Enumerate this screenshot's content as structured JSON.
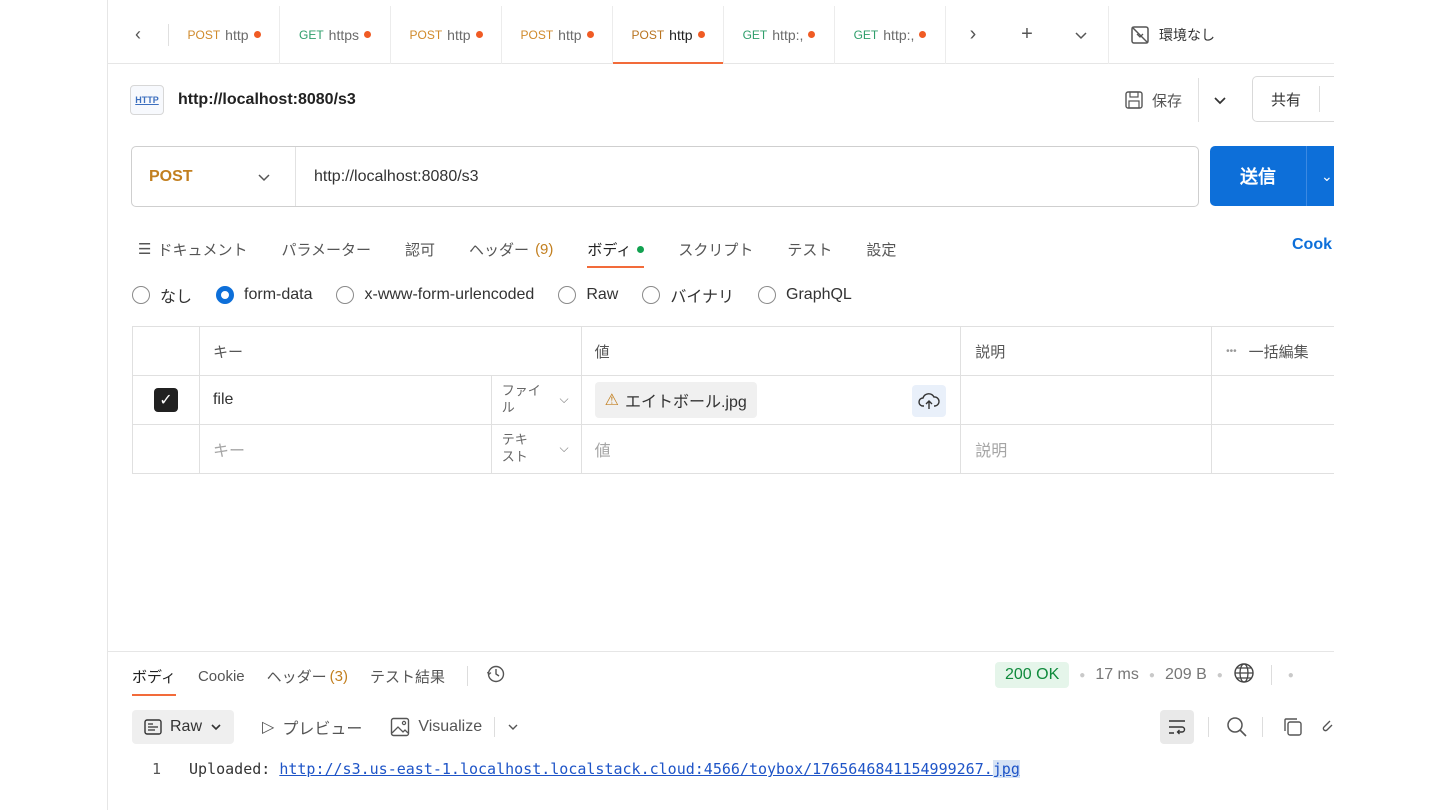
{
  "tabs": [
    {
      "method": "POST",
      "name": "http"
    },
    {
      "method": "GET",
      "name": "https"
    },
    {
      "method": "POST",
      "name": "http"
    },
    {
      "method": "POST",
      "name": "http"
    },
    {
      "method": "POST",
      "name": "http"
    },
    {
      "method": "GET",
      "name": "http:,"
    },
    {
      "method": "GET",
      "name": "http:,"
    }
  ],
  "environment": "環境なし",
  "request": {
    "badge": "HTTP",
    "title": "http://localhost:8080/s3",
    "save_label": "保存",
    "share_label": "共有",
    "method": "POST",
    "url": "http://localhost:8080/s3",
    "send_label": "送信"
  },
  "request_tabs": {
    "docs": "ドキュメント",
    "params": "パラメーター",
    "auth": "認可",
    "headers": "ヘッダー",
    "headers_count": "(9)",
    "body": "ボディ",
    "scripts": "スクリプト",
    "tests": "テスト",
    "settings": "設定",
    "cookies": "Cook"
  },
  "body_types": [
    "なし",
    "form-data",
    "x-www-form-urlencoded",
    "Raw",
    "バイナリ",
    "GraphQL"
  ],
  "table": {
    "headers": {
      "key": "キー",
      "value": "値",
      "description": "説明",
      "bulk_edit": "一括編集"
    },
    "rows": [
      {
        "key": "file",
        "type_line1": "ファイ",
        "type_line2": "ル",
        "value": "エイトボール.jpg"
      }
    ],
    "placeholder": {
      "key": "キー",
      "type_line1": "テキ",
      "type_line2": "スト",
      "value": "値",
      "description": "説明"
    }
  },
  "response_tabs": {
    "body": "ボディ",
    "cookie": "Cookie",
    "headers": "ヘッダー",
    "headers_count": "(3)",
    "test_results": "テスト結果"
  },
  "status": {
    "code": "200 OK",
    "time": "17 ms",
    "size": "209 B"
  },
  "response_toolbar": {
    "raw": "Raw",
    "preview": "プレビュー",
    "visualize": "Visualize"
  },
  "response_body": {
    "line_number": "1",
    "prefix": "Uploaded: ",
    "link_main": "http://s3.us-east-1.localhost.localstack.cloud:4566/toybox/1765646841154999267.",
    "link_ext": "jpg"
  },
  "colors": {
    "accent": "#f26b3a",
    "send": "#0d6fd9",
    "post": "#c27f1f",
    "get": "#2f9e6b",
    "ok": "#0f8a3c"
  }
}
